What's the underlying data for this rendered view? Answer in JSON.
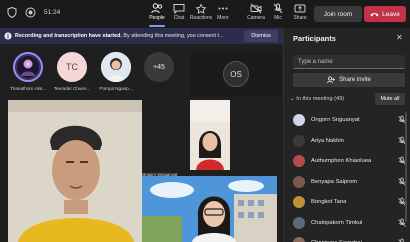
{
  "topbar": {
    "timer": "51:24",
    "tools": [
      {
        "label": "People",
        "icon": "people-icon",
        "active": true
      },
      {
        "label": "Chat",
        "icon": "chat-icon"
      },
      {
        "label": "Reactions",
        "icon": "reactions-icon"
      },
      {
        "label": "More",
        "icon": "more-icon"
      },
      {
        "label": "Camera",
        "icon": "camera-off-icon"
      },
      {
        "label": "Mic",
        "icon": "mic-off-icon"
      },
      {
        "label": "Share",
        "icon": "share-icon"
      }
    ],
    "join_label": "Join room",
    "leave_label": "Leave"
  },
  "banner": {
    "bold": "Recording and transcription have started.",
    "rest": " By attending this meeting, you consent t...",
    "dismiss": "Dismiss"
  },
  "stage": {
    "avatars": [
      {
        "name": "Thanathorn Aks...",
        "initials": ""
      },
      {
        "name": "Teeradet Chuen...",
        "initials": "TC"
      },
      {
        "name": "Pornpit Nganp...",
        "initials": ""
      }
    ],
    "more_count": "+45",
    "os_initials": "OS",
    "tile_label": "Ongorn Snguanyat"
  },
  "panel": {
    "title": "Participants",
    "search_placeholder": "Type a name",
    "share_invite": "Share invite",
    "in_meeting": "In this meeting (49)",
    "mute_all": "Mute all",
    "participants": [
      {
        "name": "Ongorn Snguanyat"
      },
      {
        "name": "Ariya Nakhin"
      },
      {
        "name": "Authumphon Khiaoluea"
      },
      {
        "name": "Benyapa Saiprom"
      },
      {
        "name": "Bongkot Tana"
      },
      {
        "name": "Chalopakorn Timkul"
      },
      {
        "name": "Chanisara Sornchai"
      }
    ]
  },
  "colors": {
    "accent": "#8f93f8",
    "leave": "#c4314b",
    "banner_bg": "#2b2e4a"
  }
}
